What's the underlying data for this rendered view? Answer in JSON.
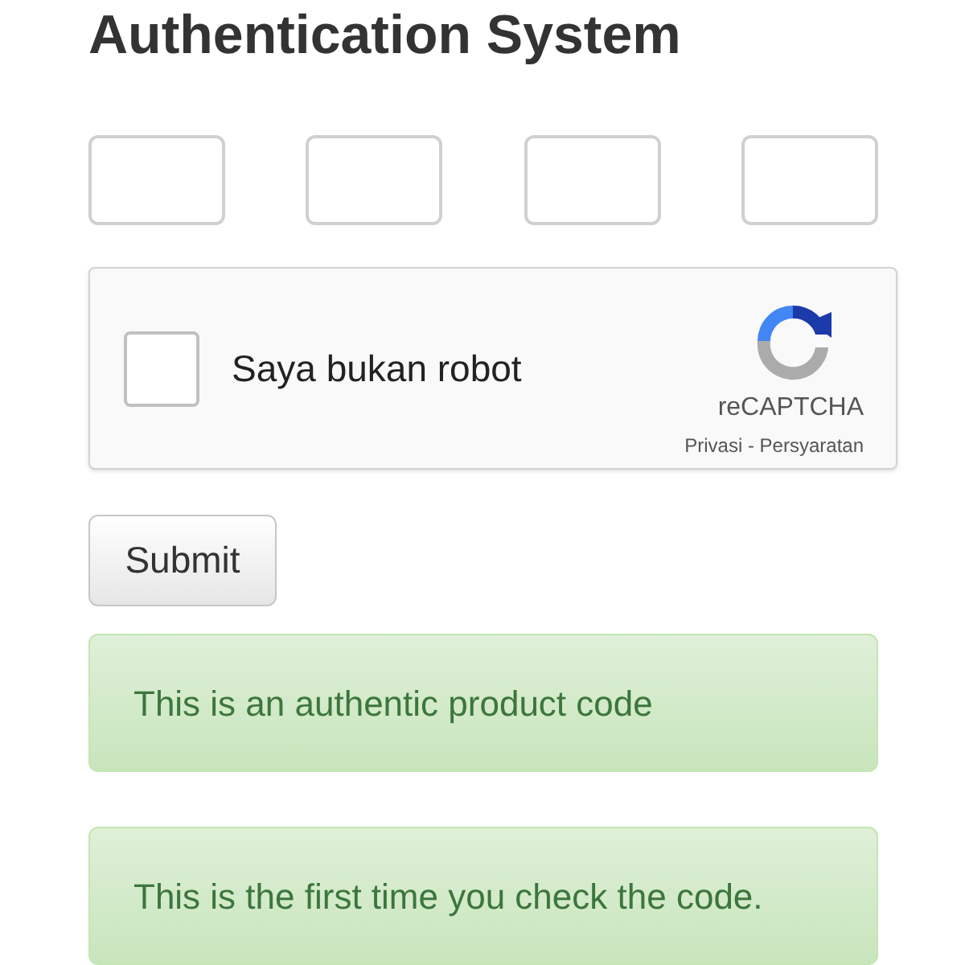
{
  "title": "Authentication System",
  "code_fields": [
    {
      "kind": "text"
    },
    {
      "kind": "text"
    },
    {
      "kind": "text"
    },
    {
      "kind": "text"
    }
  ],
  "captcha": {
    "checked": false,
    "label": "Saya bukan robot",
    "brand": "reCAPTCHA",
    "links": "Privasi - Persyaratan"
  },
  "submit": "Submit",
  "alerts": [
    "This is an authentic product code",
    "This is the first time you check the code."
  ]
}
